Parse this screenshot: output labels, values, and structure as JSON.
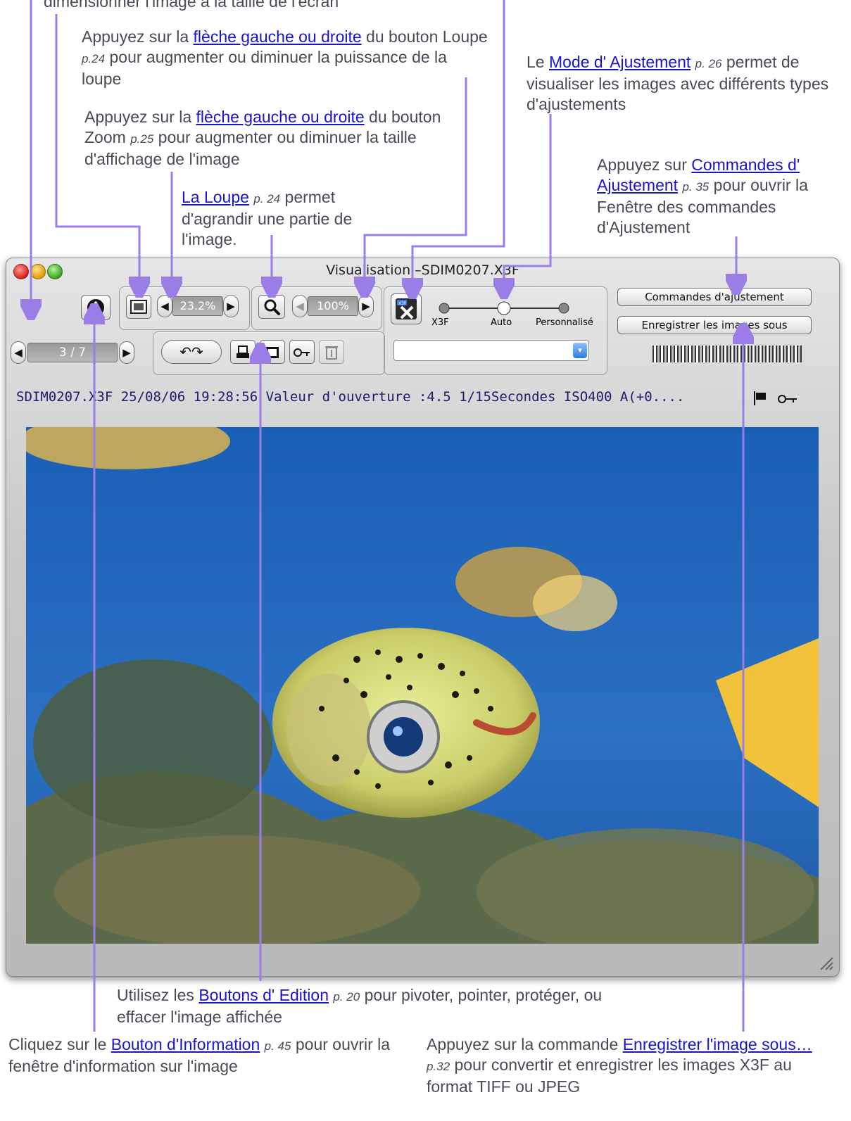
{
  "annotations": {
    "fit_screen": {
      "text": "dimensionner l'image à la taille de l'écran"
    },
    "loupe_arrows": {
      "pre": "Appuyez sur la ",
      "link": "flèche gauche ou droite",
      "post1": " du bouton Loupe ",
      "page": "p.24",
      "post2": " pour augmenter ou diminuer la puissance de la loupe"
    },
    "zoom_arrows": {
      "pre": "Appuyez sur la ",
      "link": "flèche gauche ou droite",
      "post1": " du bouton Zoom ",
      "page": "p.25",
      "post2": " pour augmenter ou diminuer la taille d'affichage de l'image"
    },
    "loupe": {
      "link": "La Loupe",
      "page": "p. 24",
      "post": " permet d'agrandir une partie de l'image."
    },
    "mode": {
      "pre": "Le ",
      "link": "Mode d' Ajustement",
      "page": "p. 26",
      "post": " permet de visualiser les images avec différents types d'ajustements"
    },
    "commands": {
      "pre": "Appuyez sur ",
      "link": "Commandes d' Ajustement",
      "page": "p. 35",
      "post": " pour ouvrir la Fenêtre des commandes d'Ajustement"
    },
    "edit_buttons": {
      "pre": "Utilisez les ",
      "link": "Boutons d' Edition",
      "page": "p. 20",
      "post": " pour pivoter, pointer, protéger, ou effacer l'image affichée"
    },
    "info_button": {
      "pre": "Cliquez sur le ",
      "link": "Bouton d'Information",
      "page": "p. 45",
      "post": " pour ouvrir la fenêtre d'information sur l'image"
    },
    "save_as": {
      "pre": "Appuyez sur la commande ",
      "link": "Enregistrer l'image sous…",
      "page": "p.32",
      "post": " pour convertir et enregistrer les images X3F au format TIFF ou JPEG"
    }
  },
  "window": {
    "title": "Visualisation –SDIM0207.X3F",
    "toolbar": {
      "zoom_value": "23.2%",
      "loupe_value": "100%",
      "page_counter": "3 / 7",
      "mode_labels": [
        "X3F",
        "Auto",
        "Personnalisé"
      ],
      "mode_selected": "Auto",
      "commands_button": "Commandes d'ajustement",
      "save_button": "Enregistrer les images sous",
      "dropdown_value": ""
    },
    "info_line": "SDIM0207.X3F 25/08/06 19:28:56 Valeur d'ouverture :4.5 1/15Secondes ISO400 A(+0...."
  },
  "colors": {
    "accent_line": "#9a7de6",
    "link": "#1a14c8"
  },
  "icons": [
    "info-icon",
    "fit-screen-icon",
    "magnifier-icon",
    "x3f-mode-icon",
    "rotate-left-icon",
    "rotate-right-icon",
    "print-icon",
    "mark-icon",
    "key-icon",
    "trash-icon",
    "flag-icon",
    "resize-grip-icon"
  ]
}
